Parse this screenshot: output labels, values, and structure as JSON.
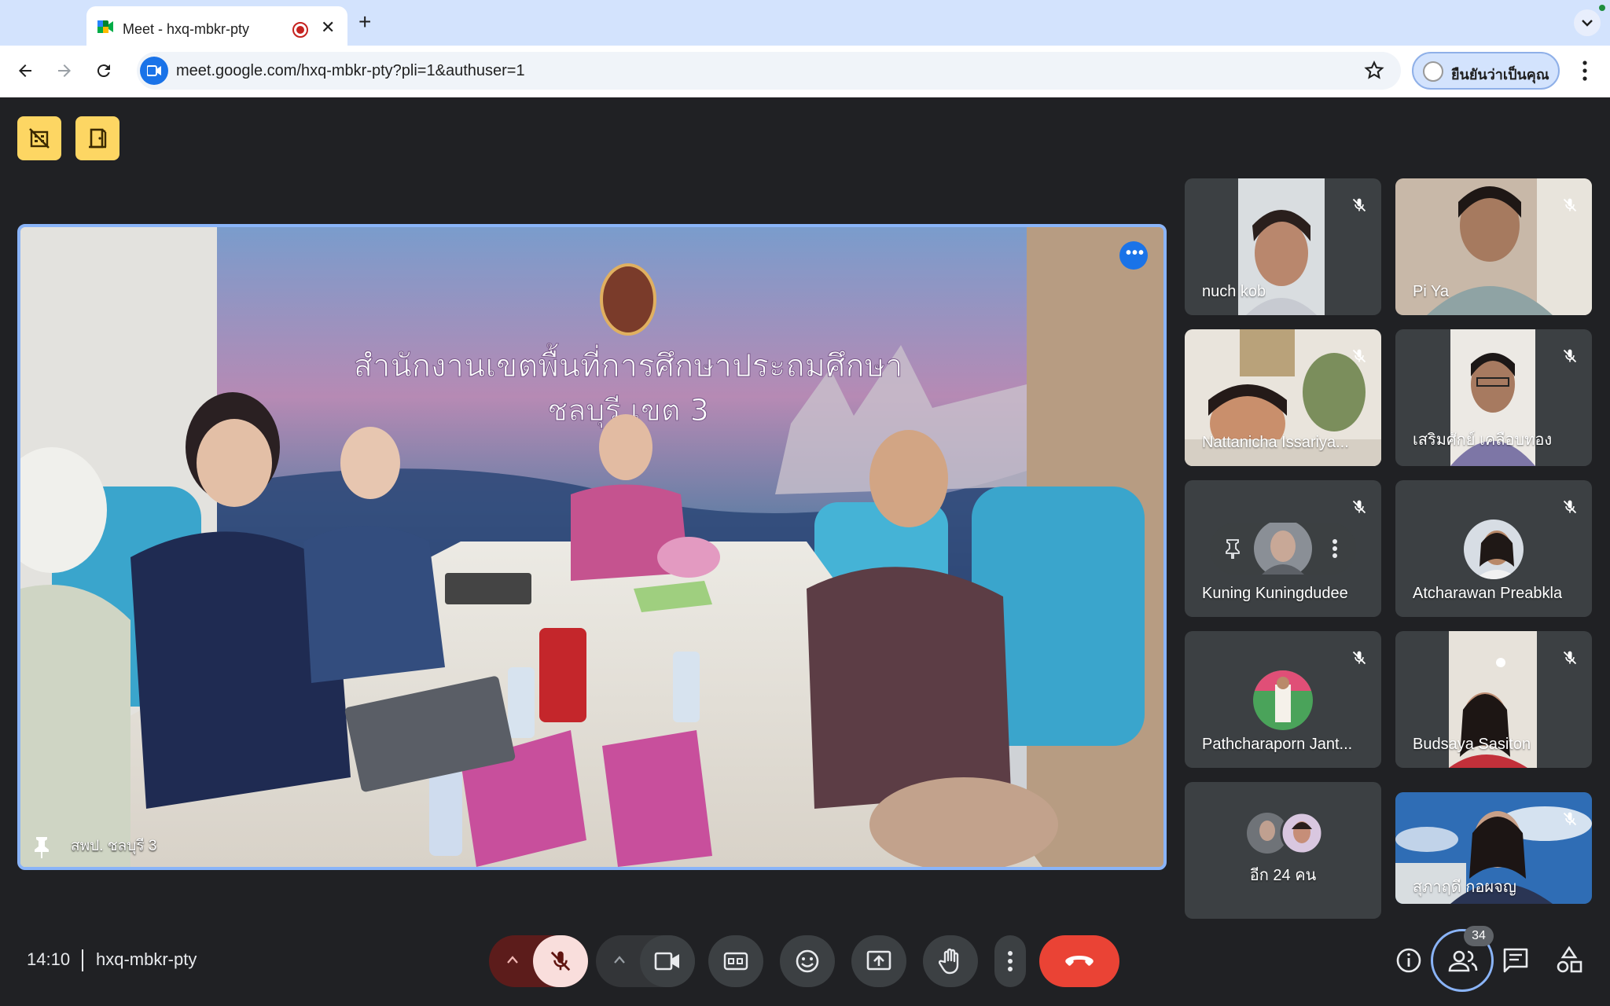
{
  "browser": {
    "tab_title": "Meet - hxq-mbkr-pty",
    "url_host": "meet.google.com",
    "url_path": "/hxq-mbkr-pty?pli=1&authuser=1",
    "verify_label": "ยืนยันว่าเป็นคุณ"
  },
  "main_tile": {
    "label": "สพป. ชลบุรี 3",
    "banner_line1": "สำนักงานเขตพื้นที่การศึกษาประถมศึกษา",
    "banner_line2": "ชลบุรี เขต 3"
  },
  "participants": [
    {
      "name": "nuch kob",
      "type": "video",
      "muted": true
    },
    {
      "name": "Pi Ya",
      "type": "video",
      "muted": true
    },
    {
      "name": "Nattanicha Issariya...",
      "type": "video",
      "muted": true
    },
    {
      "name": "เสริมศักย์ เคลือบทอง",
      "type": "video",
      "muted": true
    },
    {
      "name": "Kuning Kuningdudee",
      "type": "avatar",
      "muted": true
    },
    {
      "name": "Atcharawan Preabkla",
      "type": "avatar",
      "muted": true
    },
    {
      "name": "Pathcharaporn Jant...",
      "type": "avatar",
      "muted": true
    },
    {
      "name": "Budsaya Sasiton",
      "type": "video",
      "muted": true
    },
    {
      "name": "อีก 24 คน",
      "type": "more"
    },
    {
      "name": "สุภาฤดี กอผจญ",
      "type": "video",
      "muted": true
    }
  ],
  "bottom_bar": {
    "time": "14:10",
    "meeting_code": "hxq-mbkr-pty",
    "people_count": "34"
  },
  "colors": {
    "meet_bg": "#202124",
    "tile_bg": "#3c4043",
    "accent_blue": "#8ab4f8",
    "end_call_red": "#ea4335",
    "top_icon_yellow": "#fdd663"
  }
}
